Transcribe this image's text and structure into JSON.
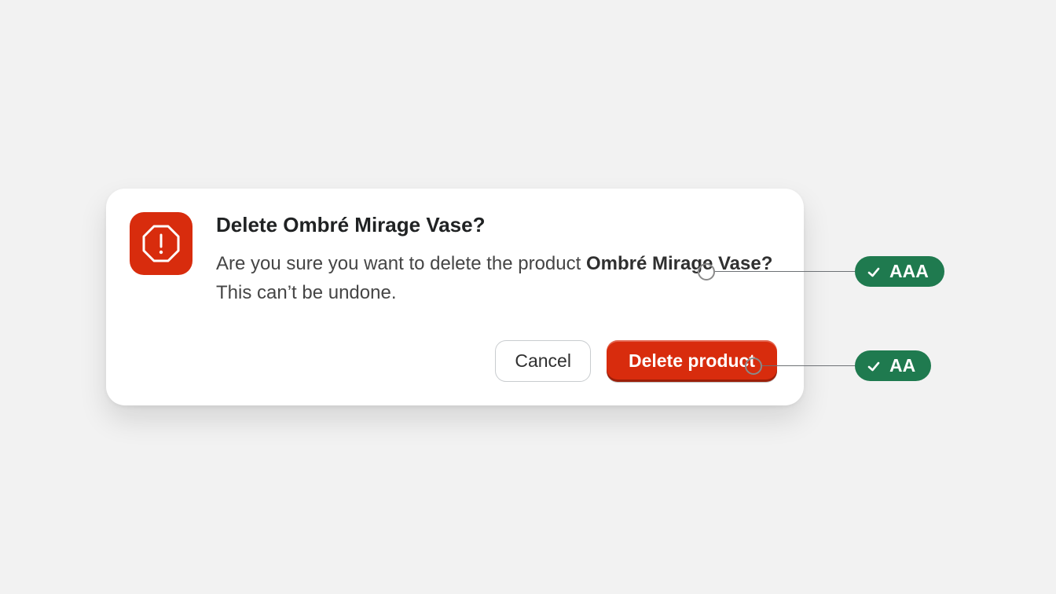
{
  "dialog": {
    "title": "Delete Ombré Mirage Vase?",
    "description_prefix": "Are you sure you want to delete the product ",
    "description_bold": "Ombré Mirage Vase?",
    "description_suffix": " This can’t be undone.",
    "cancel_label": "Cancel",
    "confirm_label": "Delete product"
  },
  "annotations": {
    "text_contrast_label": "AAA",
    "button_contrast_label": "AA"
  },
  "colors": {
    "danger": "#d82c0d",
    "success_badge": "#1f7a4f",
    "card_bg": "#ffffff",
    "page_bg": "#f2f2f2"
  }
}
